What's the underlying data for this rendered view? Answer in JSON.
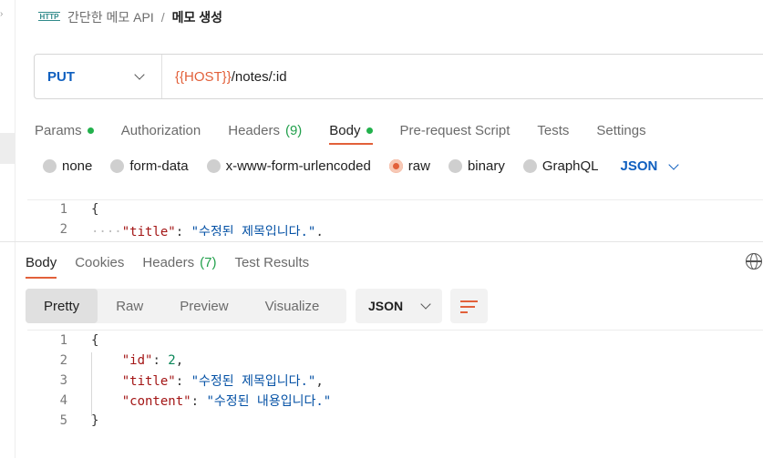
{
  "breadcrumb": {
    "icon_text": "HTTP",
    "parent": "간단한 메모 API",
    "separator": "/",
    "current": "메모 생성"
  },
  "request": {
    "method": "PUT",
    "url_variable": "{{HOST}}",
    "url_path": "/notes/:id"
  },
  "request_tabs": [
    {
      "label": "Params",
      "dot": true
    },
    {
      "label": "Authorization"
    },
    {
      "label": "Headers",
      "count": "(9)"
    },
    {
      "label": "Body",
      "dot": true,
      "active": true
    },
    {
      "label": "Pre-request Script"
    },
    {
      "label": "Tests"
    },
    {
      "label": "Settings"
    }
  ],
  "body_types": [
    "none",
    "form-data",
    "x-www-form-urlencoded",
    "raw",
    "binary",
    "GraphQL"
  ],
  "body_type_selected": "raw",
  "body_format": "JSON",
  "request_body": {
    "line1_num": "1",
    "line1": "{",
    "line2_num": "2",
    "line2_key": "\"title\"",
    "line2_value": "\"수정된 제목입니다.\""
  },
  "response_tabs": [
    {
      "label": "Body",
      "active": true
    },
    {
      "label": "Cookies"
    },
    {
      "label": "Headers",
      "count": "(7)"
    },
    {
      "label": "Test Results"
    }
  ],
  "response_views": [
    "Pretty",
    "Raw",
    "Preview",
    "Visualize"
  ],
  "response_view_selected": "Pretty",
  "response_format": "JSON",
  "response_body": [
    {
      "num": "1",
      "text": "{"
    },
    {
      "num": "2",
      "key": "\"id\"",
      "value": "2",
      "value_type": "number",
      "trail": ","
    },
    {
      "num": "3",
      "key": "\"title\"",
      "value": "\"수정된 제목입니다.\"",
      "value_type": "string",
      "trail": ","
    },
    {
      "num": "4",
      "key": "\"content\"",
      "value": "\"수정된 내용입니다.\"",
      "value_type": "string",
      "trail": ""
    },
    {
      "num": "5",
      "text": "}"
    }
  ],
  "colors": {
    "accent": "#e2603a",
    "method": "#0f5fbf",
    "active_dot": "#22b14c"
  }
}
